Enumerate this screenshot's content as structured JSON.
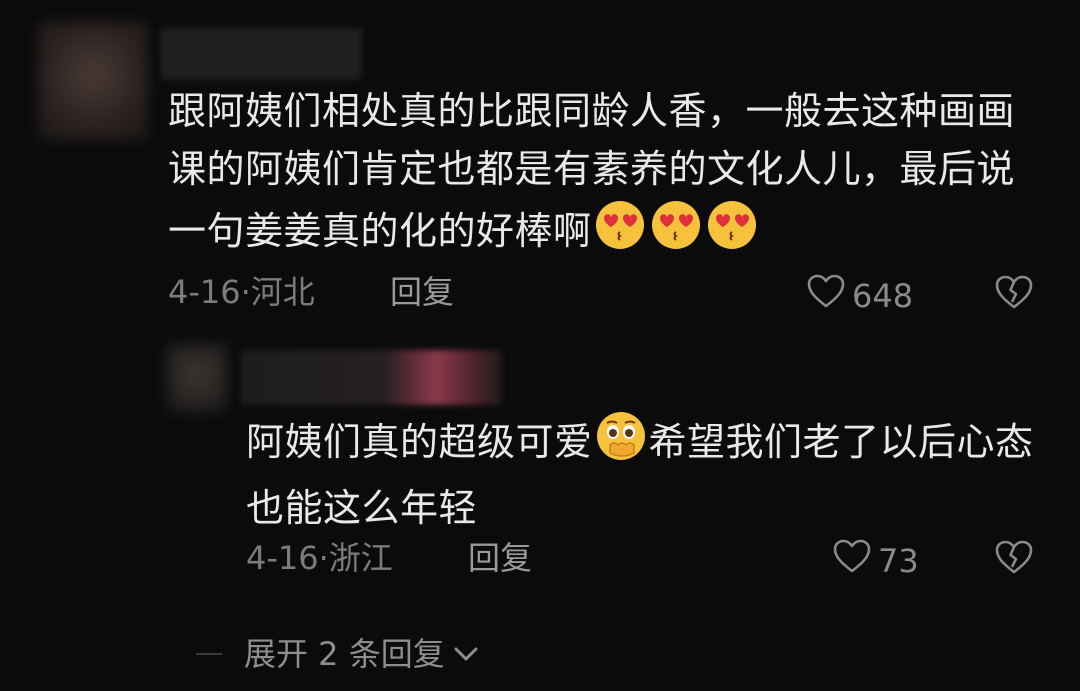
{
  "comment": {
    "text_before_emoji": "跟阿姨们相处真的比跟同龄人香，一般去这种画画课的阿姨们肯定也都是有素养的文化人儿，最后说一句姜姜真的化的好棒啊",
    "emoji": "heart-eyes-emoji",
    "emoji_count": 3,
    "date": "4-16",
    "separator": "·",
    "location": "河北",
    "reply_label": "回复",
    "likes": "648"
  },
  "reply": {
    "text_part1": "阿姨们真的超级可爱",
    "emoji": "pleading-face-emoji",
    "text_part2": "希望我们老了以后心态也能这么年轻",
    "date": "4-16",
    "separator": "·",
    "location": "浙江",
    "reply_label": "回复",
    "likes": "73"
  },
  "expand": {
    "label": "展开 2 条回复"
  },
  "colors": {
    "background": "#0b0b0b",
    "text": "#e9e9e9",
    "meta": "#7c7c7c",
    "emoji_face": "#f6c23c",
    "emoji_heart": "#e0303d"
  }
}
